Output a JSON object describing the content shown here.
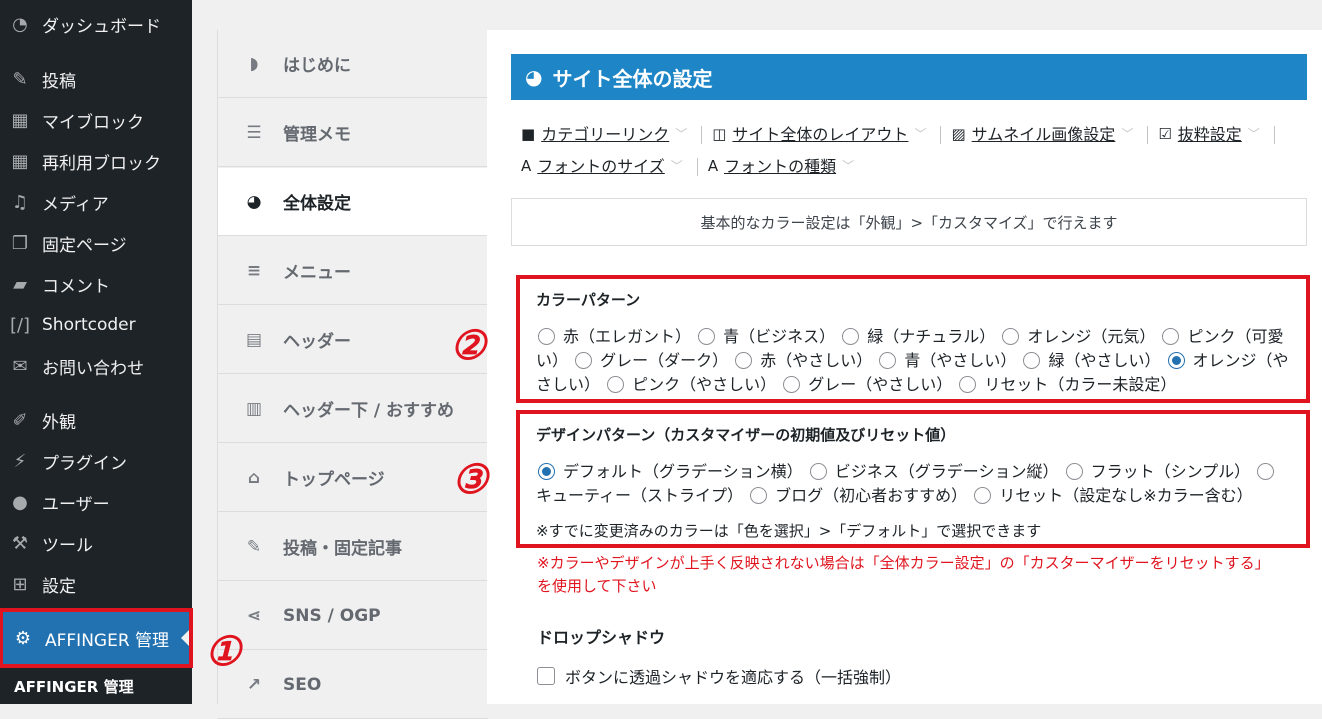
{
  "sidebar": {
    "items": [
      {
        "label": "ダッシュボード",
        "icon": "dashboard-icon"
      },
      {
        "label": "投稿",
        "icon": "pin-icon"
      },
      {
        "label": "マイブロック",
        "icon": "grid-icon"
      },
      {
        "label": "再利用ブロック",
        "icon": "grid-icon"
      },
      {
        "label": "メディア",
        "icon": "media-icon"
      },
      {
        "label": "固定ページ",
        "icon": "pages-icon"
      },
      {
        "label": "コメント",
        "icon": "comment-icon"
      },
      {
        "label": "Shortcoder",
        "icon": "shortcode-icon"
      },
      {
        "label": "お問い合わせ",
        "icon": "mail-icon"
      },
      {
        "label": "外観",
        "icon": "brush-icon"
      },
      {
        "label": "プラグイン",
        "icon": "plugin-icon"
      },
      {
        "label": "ユーザー",
        "icon": "user-icon"
      },
      {
        "label": "ツール",
        "icon": "wrench-icon"
      },
      {
        "label": "設定",
        "icon": "settings-icon"
      }
    ],
    "active": {
      "label": "AFFINGER 管理",
      "icon": "gear-icon"
    },
    "submenu": "AFFINGER 管理"
  },
  "tabs": [
    {
      "label": "はじめに",
      "icon": "shield-icon"
    },
    {
      "label": "管理メモ",
      "icon": "document-icon"
    },
    {
      "label": "全体設定",
      "icon": "palette-icon",
      "active": true
    },
    {
      "label": "メニュー",
      "icon": "menu-icon"
    },
    {
      "label": "ヘッダー",
      "icon": "header-icon"
    },
    {
      "label": "ヘッダー下 / おすすめ",
      "icon": "header-below-icon"
    },
    {
      "label": "トップページ",
      "icon": "home-icon"
    },
    {
      "label": "投稿・固定記事",
      "icon": "edit-icon"
    },
    {
      "label": "SNS / OGP",
      "icon": "share-icon"
    },
    {
      "label": "SEO",
      "icon": "chart-icon"
    }
  ],
  "main": {
    "title": "サイト全体の設定",
    "links": [
      {
        "label": "カテゴリーリンク",
        "icon": "folder-icon"
      },
      {
        "label": "サイト全体のレイアウト",
        "icon": "layout-icon"
      },
      {
        "label": "サムネイル画像設定",
        "icon": "image-icon"
      },
      {
        "label": "抜粋設定",
        "icon": "excerpt-icon"
      },
      {
        "label": "フォントのサイズ",
        "icon": "font-icon"
      },
      {
        "label": "フォントの種類",
        "icon": "font-icon"
      }
    ],
    "notice": "基本的なカラー設定は「外観」>「カスタマイズ」で行えます",
    "color_pattern": {
      "title": "カラーパターン",
      "options": [
        "赤（エレガント）",
        "青（ビジネス）",
        "緑（ナチュラル）",
        "オレンジ（元気）",
        "ピンク（可愛い）",
        "グレー（ダーク）",
        "赤（やさしい）",
        "青（やさしい）",
        "緑（やさしい）",
        "オレンジ（やさしい）",
        "ピンク（やさしい）",
        "グレー（やさしい）",
        "リセット（カラー未設定）"
      ],
      "selected": 9
    },
    "design_pattern": {
      "title": "デザインパターン（カスタマイザーの初期値及びリセット値）",
      "options": [
        "デフォルト（グラデーション横）",
        "ビジネス（グラデーション縦）",
        "フラット（シンプル）",
        "キューティー（ストライプ）",
        "ブログ（初心者おすすめ）",
        "リセット（設定なし※カラー含む）"
      ],
      "selected": 0,
      "note": "※すでに変更済みのカラーは「色を選択」>「デフォルト」で選択できます"
    },
    "warning": "※カラーやデザインが上手く反映されない場合は「全体カラー設定」の「カスターマイザーをリセットする」を使用して下さい",
    "drop_shadow": {
      "title": "ドロップシャドウ",
      "checkbox": "ボタンに透過シャドウを適応する（一括強制）"
    }
  },
  "annotations": [
    "①",
    "②",
    "③"
  ],
  "colors": {
    "accent": "#1e86c6",
    "sidebar": "#1d2327",
    "active": "#2271b1",
    "highlight": "#e0141e"
  }
}
